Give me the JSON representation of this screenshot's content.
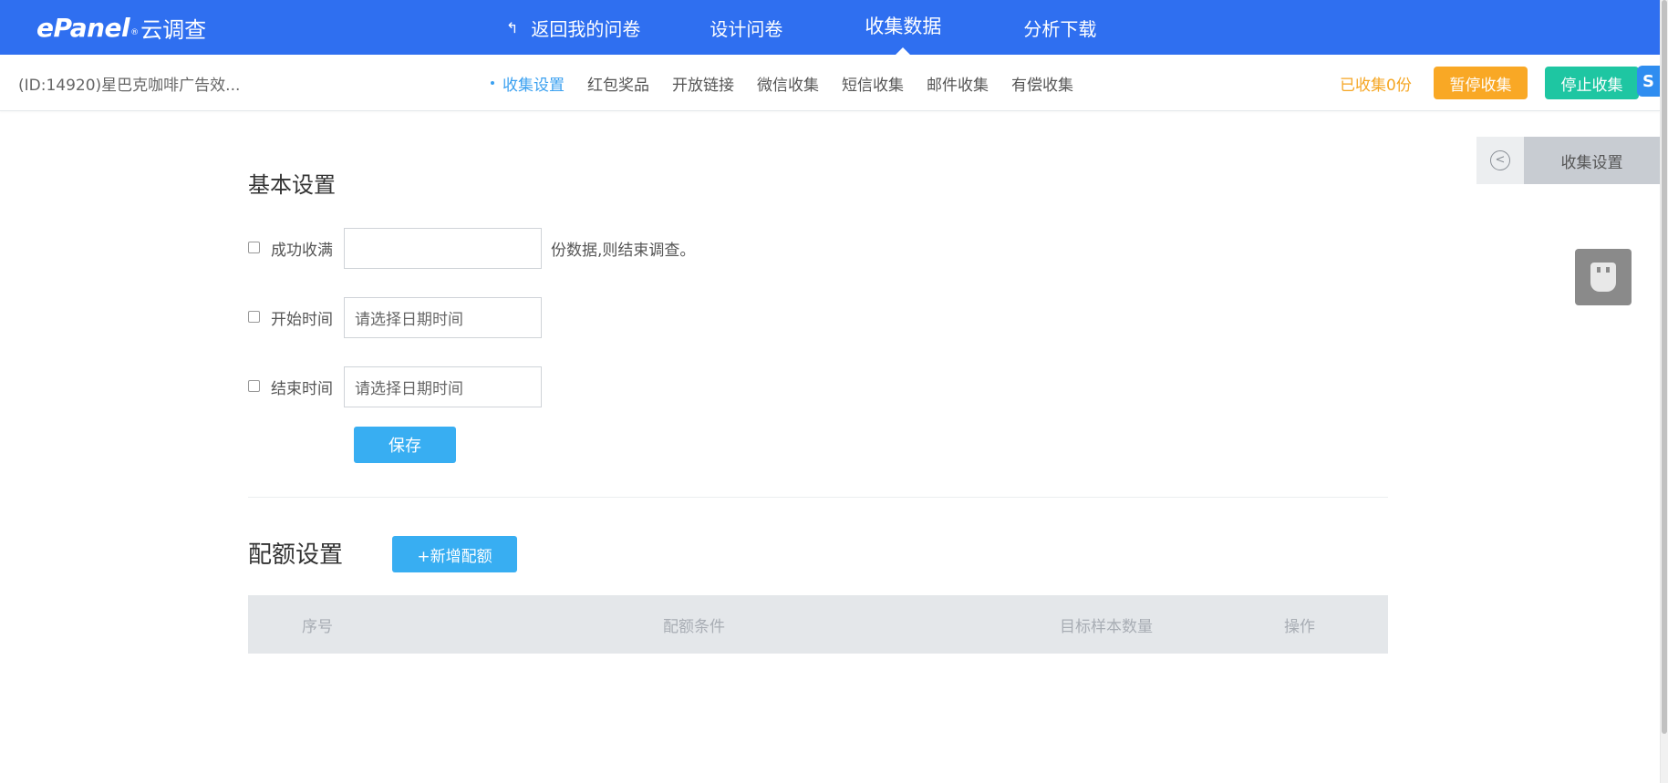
{
  "header": {
    "logo_brand": "ePanel",
    "logo_reg": "®",
    "logo_cn": "云调查",
    "nav": {
      "back_label": "返回我的问卷",
      "design_label": "设计问卷",
      "collect_label": "收集数据",
      "analysis_label": "分析下载"
    }
  },
  "subbar": {
    "survey_title": "(ID:14920)星巴克咖啡广告效...",
    "tabs": [
      "收集设置",
      "红包奖品",
      "开放链接",
      "微信收集",
      "短信收集",
      "邮件收集",
      "有偿收集"
    ],
    "collected_text": "已收集0份",
    "pause_label": "暂停收集",
    "stop_label": "停止收集",
    "float_icon_glyph": "S"
  },
  "side_panel": {
    "tab_label": "收集设置",
    "back_glyph": "<"
  },
  "basic": {
    "title": "基本设置",
    "row1": {
      "label": "成功收满",
      "value": "",
      "suffix": "份数据,则结束调查。"
    },
    "row2": {
      "label": "开始时间",
      "placeholder": "请选择日期时间"
    },
    "row3": {
      "label": "结束时间",
      "placeholder": "请选择日期时间"
    },
    "save_label": "保存"
  },
  "quota": {
    "title": "配额设置",
    "add_label": "+新增配额",
    "columns": [
      "序号",
      "配额条件",
      "目标样本数量",
      "操作"
    ]
  },
  "colors": {
    "primary_bar": "#2f6ff0",
    "active_tab": "#3aa0f0",
    "pause_button": "#f9a825",
    "stop_button": "#1ec6a2",
    "collected_text": "#f5a623"
  }
}
